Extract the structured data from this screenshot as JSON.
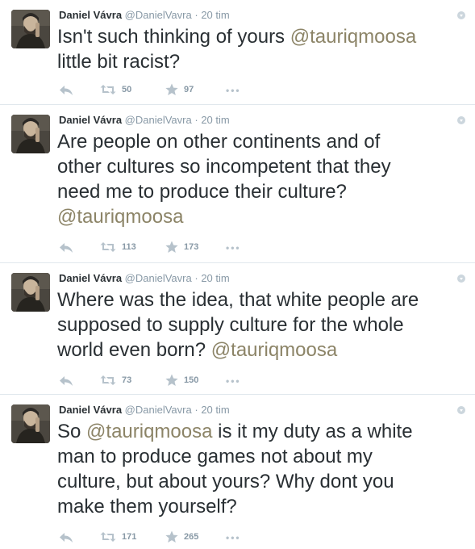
{
  "tweets": [
    {
      "name": "Daniel Vávra",
      "handle": "@DanielVavra",
      "separator": "·",
      "time": "20 tim",
      "text_lines": [
        [
          {
            "t": "Isn't such thinking of yours "
          },
          {
            "t": "@tauriqmoosa",
            "m": true
          }
        ],
        [
          {
            "t": "little bit racist?"
          }
        ]
      ],
      "retweets": "50",
      "favorites": "97"
    },
    {
      "name": "Daniel Vávra",
      "handle": "@DanielVavra",
      "separator": "·",
      "time": "20 tim",
      "text_lines": [
        [
          {
            "t": "Are people on other continents and of"
          }
        ],
        [
          {
            "t": "other cultures so incompetent that they"
          }
        ],
        [
          {
            "t": "need me to produce their culture?"
          }
        ],
        [
          {
            "t": "@tauriqmoosa",
            "m": true
          }
        ]
      ],
      "retweets": "113",
      "favorites": "173"
    },
    {
      "name": "Daniel Vávra",
      "handle": "@DanielVavra",
      "separator": "·",
      "time": "20 tim",
      "text_lines": [
        [
          {
            "t": "Where was the idea, that white people are"
          }
        ],
        [
          {
            "t": "supposed to supply culture for the whole"
          }
        ],
        [
          {
            "t": "world even born? "
          },
          {
            "t": "@tauriqmoosa",
            "m": true
          }
        ]
      ],
      "retweets": "73",
      "favorites": "150"
    },
    {
      "name": "Daniel Vávra",
      "handle": "@DanielVavra",
      "separator": "·",
      "time": "20 tim",
      "text_lines": [
        [
          {
            "t": "So "
          },
          {
            "t": "@tauriqmoosa",
            "m": true
          },
          {
            "t": " is it my duty as a white"
          }
        ],
        [
          {
            "t": "man to produce games not about my"
          }
        ],
        [
          {
            "t": "culture, but about yours? Why dont you"
          }
        ],
        [
          {
            "t": "make them yourself?"
          }
        ]
      ],
      "retweets": "171",
      "favorites": "265"
    }
  ],
  "icons": {
    "reply": "reply-icon",
    "retweet": "retweet-icon",
    "favorite": "star-icon",
    "more": "more-icon",
    "caret": "caret-down-icon"
  },
  "colors": {
    "mention": "#8c8467",
    "meta": "#8899a6",
    "icon": "#b6c2cb",
    "divider": "#e1e8ed"
  },
  "more_label": "•••"
}
